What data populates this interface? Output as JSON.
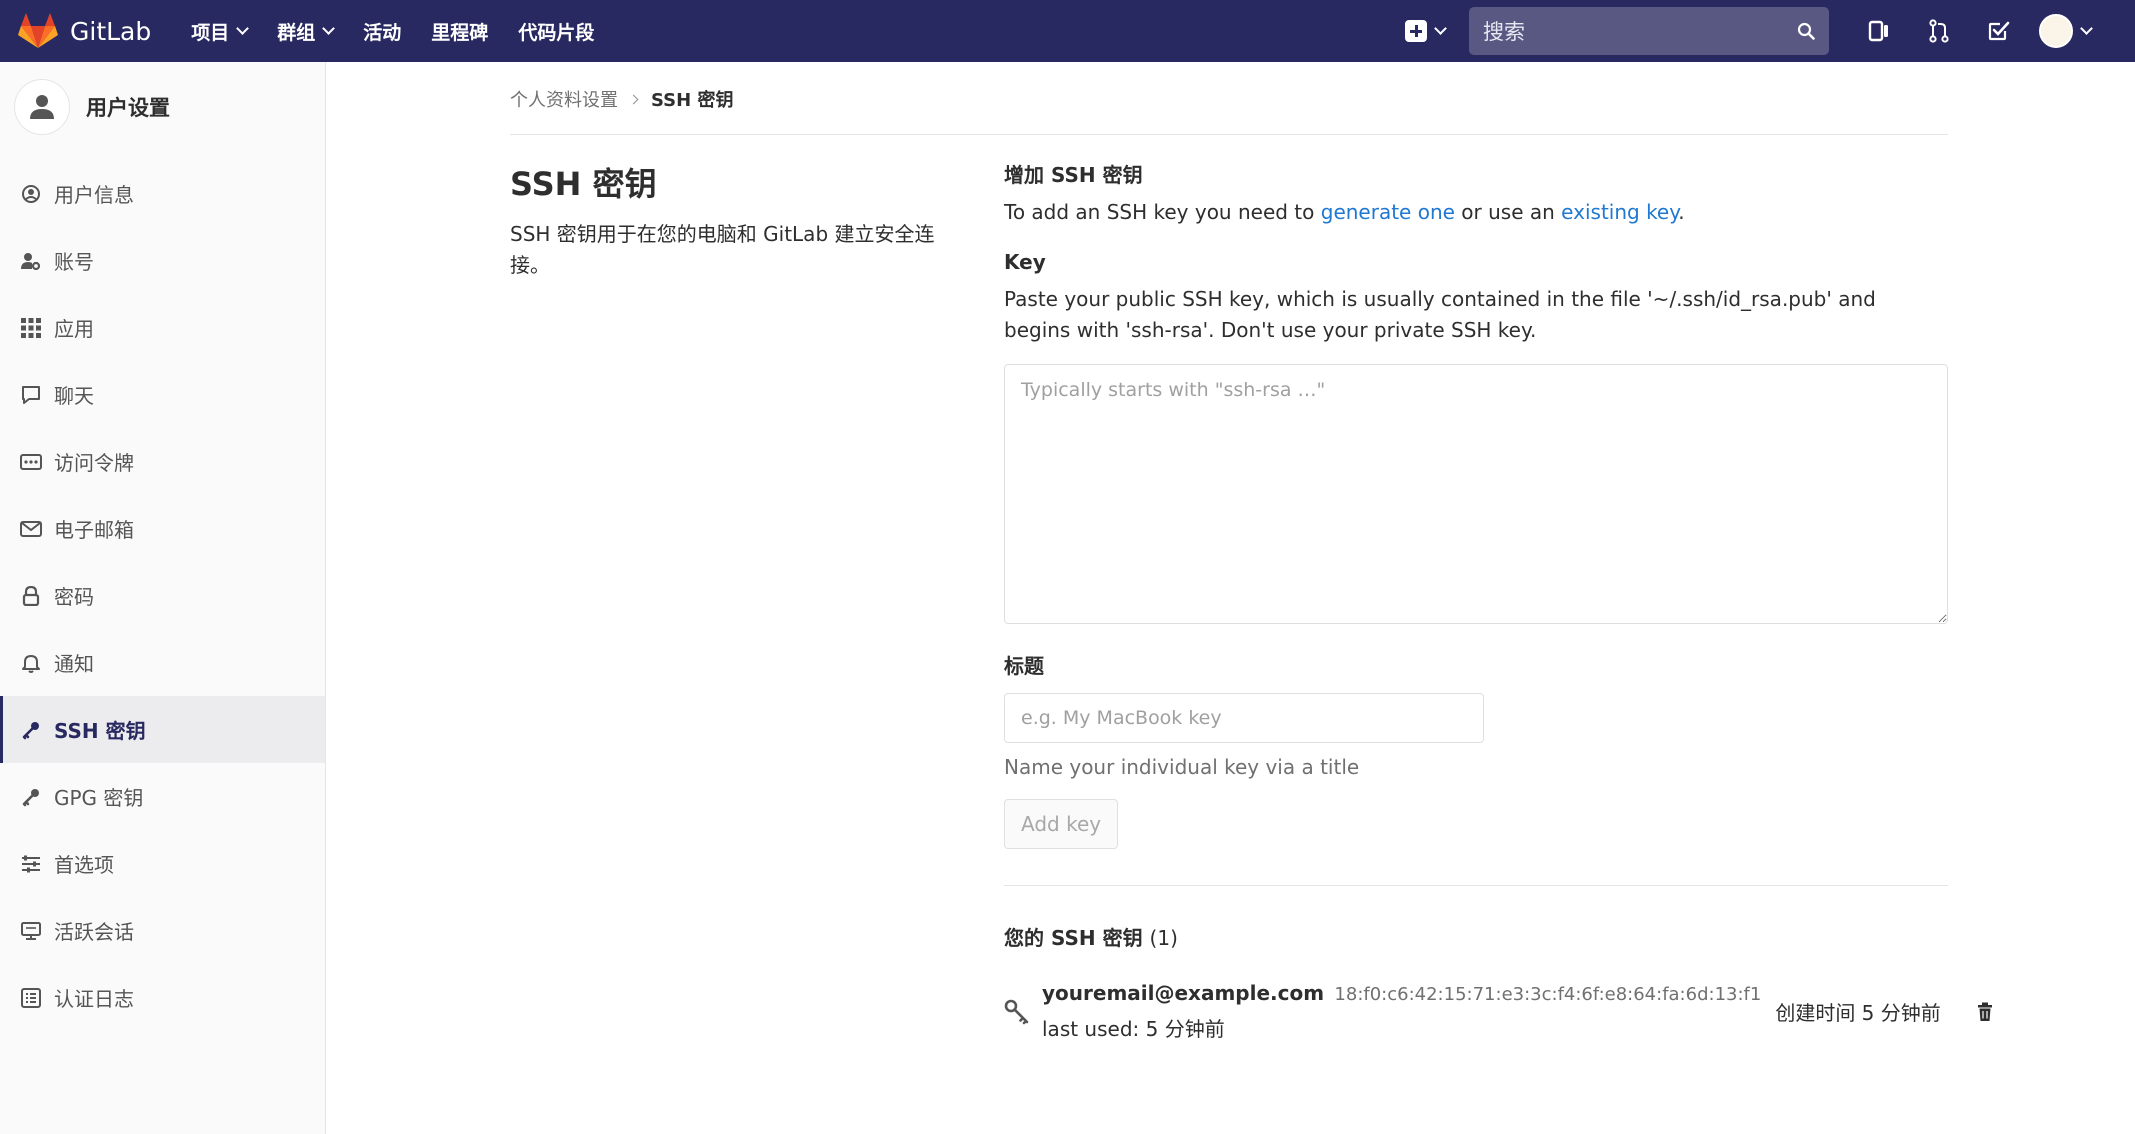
{
  "topnav": {
    "brand": "GitLab",
    "links": [
      {
        "label": "项目",
        "dropdown": true
      },
      {
        "label": "群组",
        "dropdown": true
      },
      {
        "label": "活动",
        "dropdown": false
      },
      {
        "label": "里程碑",
        "dropdown": false
      },
      {
        "label": "代码片段",
        "dropdown": false
      }
    ],
    "search_placeholder": "搜索",
    "icons": [
      "plus-square-icon",
      "search-icon",
      "panel-icon",
      "merge-request-icon",
      "todo-check-icon",
      "avatar"
    ]
  },
  "sidebar": {
    "title": "用户设置",
    "items": [
      {
        "label": "用户信息",
        "icon": "user-circle-icon",
        "active": false
      },
      {
        "label": "账号",
        "icon": "user-gear-icon",
        "active": false
      },
      {
        "label": "应用",
        "icon": "grid-icon",
        "active": false
      },
      {
        "label": "聊天",
        "icon": "comment-icon",
        "active": false
      },
      {
        "label": "访问令牌",
        "icon": "token-icon",
        "active": false
      },
      {
        "label": "电子邮箱",
        "icon": "envelope-icon",
        "active": false
      },
      {
        "label": "密码",
        "icon": "lock-icon",
        "active": false
      },
      {
        "label": "通知",
        "icon": "bell-icon",
        "active": false
      },
      {
        "label": "SSH 密钥",
        "icon": "key-icon",
        "active": true
      },
      {
        "label": "GPG 密钥",
        "icon": "key-icon",
        "active": false
      },
      {
        "label": "首选项",
        "icon": "sliders-icon",
        "active": false
      },
      {
        "label": "活跃会话",
        "icon": "monitor-icon",
        "active": false
      },
      {
        "label": "认证日志",
        "icon": "list-icon",
        "active": false
      }
    ]
  },
  "breadcrumb": {
    "parent": "个人资料设置",
    "current": "SSH 密钥"
  },
  "page": {
    "title": "SSH 密钥",
    "description": "SSH 密钥用于在您的电脑和 GitLab 建立安全连接。"
  },
  "add_key": {
    "title": "增加 SSH 密钥",
    "intro_prefix": "To add an SSH key you need to ",
    "intro_link1": "generate one",
    "intro_middle": " or use an ",
    "intro_link2": "existing key",
    "intro_suffix": ".",
    "key_label": "Key",
    "key_help": "Paste your public SSH key, which is usually contained in the file '~/.ssh/id_rsa.pub' and begins with 'ssh-rsa'. Don't use your private SSH key.",
    "key_placeholder": "Typically starts with \"ssh-rsa …\"",
    "title_label": "标题",
    "title_placeholder": "e.g. My MacBook key",
    "title_help": "Name your individual key via a title",
    "button": "Add key"
  },
  "keys_list": {
    "heading": "您的 SSH 密钥",
    "count": "(1)",
    "items": [
      {
        "email": "youremail@example.com",
        "fingerprint": "18:f0:c6:42:15:71:e3:3c:f4:6f:e8:64:fa:6d:13:f1",
        "last_used": "last used: 5 分钟前",
        "created": "创建时间 5 分钟前"
      }
    ]
  },
  "colors": {
    "nav_bg": "#292961",
    "link": "#1f78d1",
    "sidebar_bg": "#fafafa",
    "active_item_bg": "#ececef"
  }
}
